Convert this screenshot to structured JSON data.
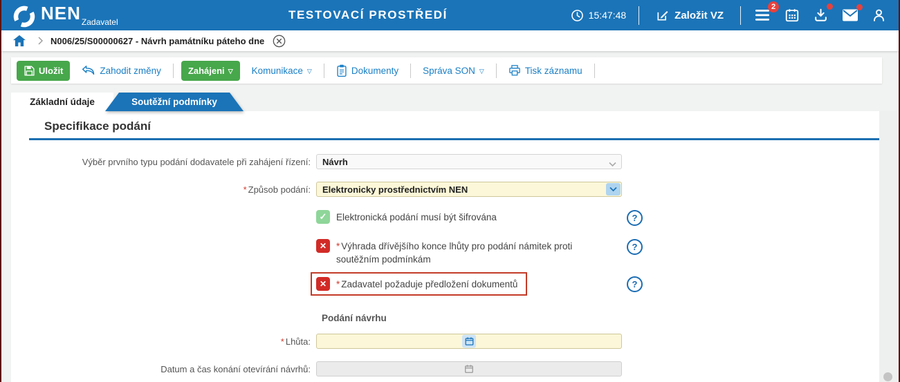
{
  "header": {
    "brand": "NEN",
    "brand_sub": "Zadavatel",
    "env_title": "TESTOVACÍ PROSTŘEDÍ",
    "clock_time": "15:47:48",
    "create_vz": "Založit VZ",
    "tasks_badge": "2"
  },
  "breadcrumb": {
    "record_title": "N006/25/S00000627 - Návrh památníku páteho dne"
  },
  "toolbar": {
    "save": "Uložit",
    "discard": "Zahodit změny",
    "start": "Zahájeni",
    "communication": "Komunikace",
    "documents": "Dokumenty",
    "admin_son": "Správa SON",
    "print": "Tisk záznamu"
  },
  "tabs": [
    {
      "label": "Základní údaje",
      "active": true
    },
    {
      "label": "Soutěžní podmínky",
      "active": false
    }
  ],
  "section": {
    "title": "Specifikace podání"
  },
  "form": {
    "first_type": {
      "label": "Výběr prvního typu podání dodavatele při zahájení řízení:",
      "value": "Návrh",
      "disabled": true
    },
    "method": {
      "label": "Způsob podání:",
      "value": "Elektronicky prostřednictvím NEN",
      "required": true
    },
    "encrypted": {
      "label": "Elektronická podání musí být šifrována",
      "checked": true
    },
    "reservation": {
      "label": "Výhrada dřívějšího konce lhůty pro podání námitek proti soutěžním podmínkám",
      "required": true,
      "checked": false
    },
    "requires_docs": {
      "label": "Zadavatel požaduje předložení dokumentů",
      "required": true,
      "checked": false,
      "highlighted": true
    },
    "subsection": "Podání návrhu",
    "deadline": {
      "label": "Lhůta:",
      "value": "",
      "required": true
    },
    "opening": {
      "label": "Datum a čas konání otevírání návrhů:",
      "value": "",
      "disabled": true
    }
  },
  "misc": {
    "required": "*",
    "dropdown": "▽",
    "check": "✓",
    "cross": "✕",
    "help": "?"
  },
  "colors": {
    "header_blue": "#1b74b8",
    "link_blue": "#1b80c6",
    "button_green": "#47a74b",
    "field_yellow": "#fbf7d8",
    "checkbox_green": "#8ed699",
    "checkbox_red": "#d22b27",
    "highlight_red": "#c43b28",
    "badge_red": "#e8413c"
  }
}
